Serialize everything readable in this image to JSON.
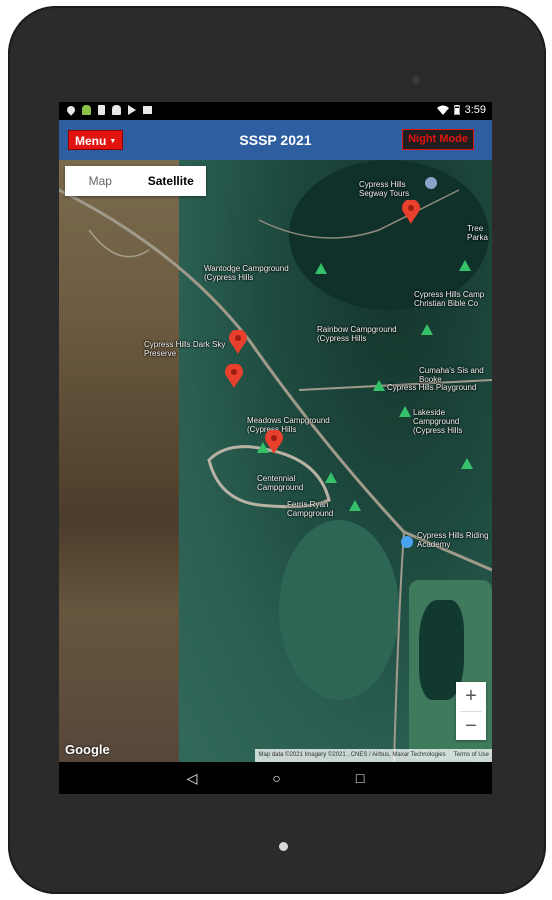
{
  "status_bar": {
    "time": "3:59"
  },
  "app_bar": {
    "menu_label": "Menu",
    "title": "SSSP 2021",
    "night_mode_label": "Night Mode"
  },
  "map": {
    "map_type": {
      "map_label": "Map",
      "satellite_label": "Satellite",
      "selected": "Satellite"
    },
    "places": [
      {
        "name": "Cypress Hills Segway Tours"
      },
      {
        "name": "Tree Parka"
      },
      {
        "name": "Wantodge Campground (Cypress Hills"
      },
      {
        "name": "Cypress Hills Camp Christian Bible Co"
      },
      {
        "name": "Cypress Hills Dark Sky Preserve"
      },
      {
        "name": "Rainbow Campground (Cypress Hills"
      },
      {
        "name": "Cumaha's Sis and Booke"
      },
      {
        "name": "Cypress Hills Playground"
      },
      {
        "name": "Meadows Campground (Cypress Hills"
      },
      {
        "name": "Lakeside Campground (Cypress Hills"
      },
      {
        "name": "Centennial Campground"
      },
      {
        "name": "Ferris Ryan Campground"
      },
      {
        "name": "Cypress Hills Riding Academy"
      }
    ],
    "zoom_in_label": "+",
    "zoom_out_label": "−",
    "google_logo": "Google",
    "attribution": "Map data ©2021 Imagery ©2021 , CNES / Airbus, Maxar Technologies",
    "terms": "Terms of Use"
  },
  "nav": {
    "back": "◁",
    "home": "○",
    "recents": "□"
  },
  "colors": {
    "app_bar": "#2e5ea0",
    "menu_button": "#e3140f",
    "night_mode_text": "#e3140f",
    "marker": "#e8402c",
    "poi_icon": "#35c16a"
  }
}
